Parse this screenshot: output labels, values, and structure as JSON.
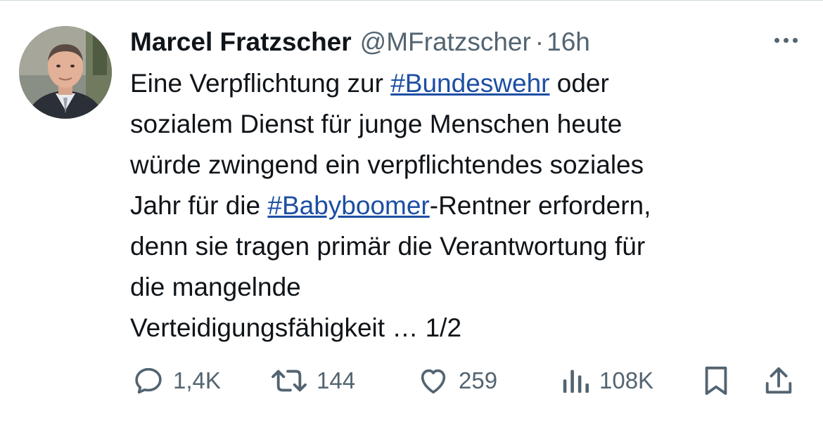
{
  "tweet": {
    "author_name": "Marcel Fratzscher",
    "handle": "@MFratzscher",
    "separator": "·",
    "time": "16h",
    "body": {
      "line1_pre": "Eine Verpflichtung zur ",
      "hashtag1": "#Bundeswehr",
      "line1_post": " oder",
      "line2": "sozialem Dienst für junge Menschen heute",
      "line3": "würde zwingend ein verpflichtendes soziales",
      "line4_pre": "Jahr für die ",
      "hashtag2": "#Babyboomer",
      "line4_post": "-Rentner erfordern,",
      "line5": "denn sie tragen primär die Verantwortung für",
      "line6": "die mangelnde",
      "line7": "Verteidigungsfähigkeit … 1/2"
    }
  },
  "actions": {
    "reply_count": "1,4K",
    "repost_count": "144",
    "like_count": "259",
    "views_count": "108K"
  },
  "icons": {
    "more": "more-horizontal-icon",
    "reply": "reply-icon",
    "repost": "repost-icon",
    "like": "heart-icon",
    "views": "views-icon",
    "bookmark": "bookmark-icon",
    "share": "share-icon"
  },
  "colors": {
    "text": "#0f1419",
    "secondary": "#536471",
    "hashtag": "#1d4fa3",
    "background": "#ffffff"
  }
}
